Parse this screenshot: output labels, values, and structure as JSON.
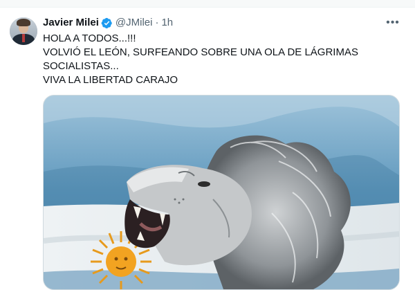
{
  "tweet": {
    "author_name": "Javier Milei",
    "handle": "@JMilei",
    "separator": "·",
    "time": "1h",
    "more_label": "•••",
    "lines": [
      "HOLA A TODOS...!!!",
      "VOLVIÓ EL LEÓN, SURFEANDO SOBRE UNA OLA DE LÁGRIMAS",
      "SOCIALISTAS...",
      "VIVA LA LIBERTAD CARAJO"
    ]
  },
  "icons": {
    "verified": "verified-badge-icon",
    "more": "more-options-icon"
  },
  "colors": {
    "verified_blue": "#1d9bf0",
    "secondary_text": "#536471",
    "flag_sky": "#6fa3c3",
    "sun_gold": "#f2a321"
  }
}
